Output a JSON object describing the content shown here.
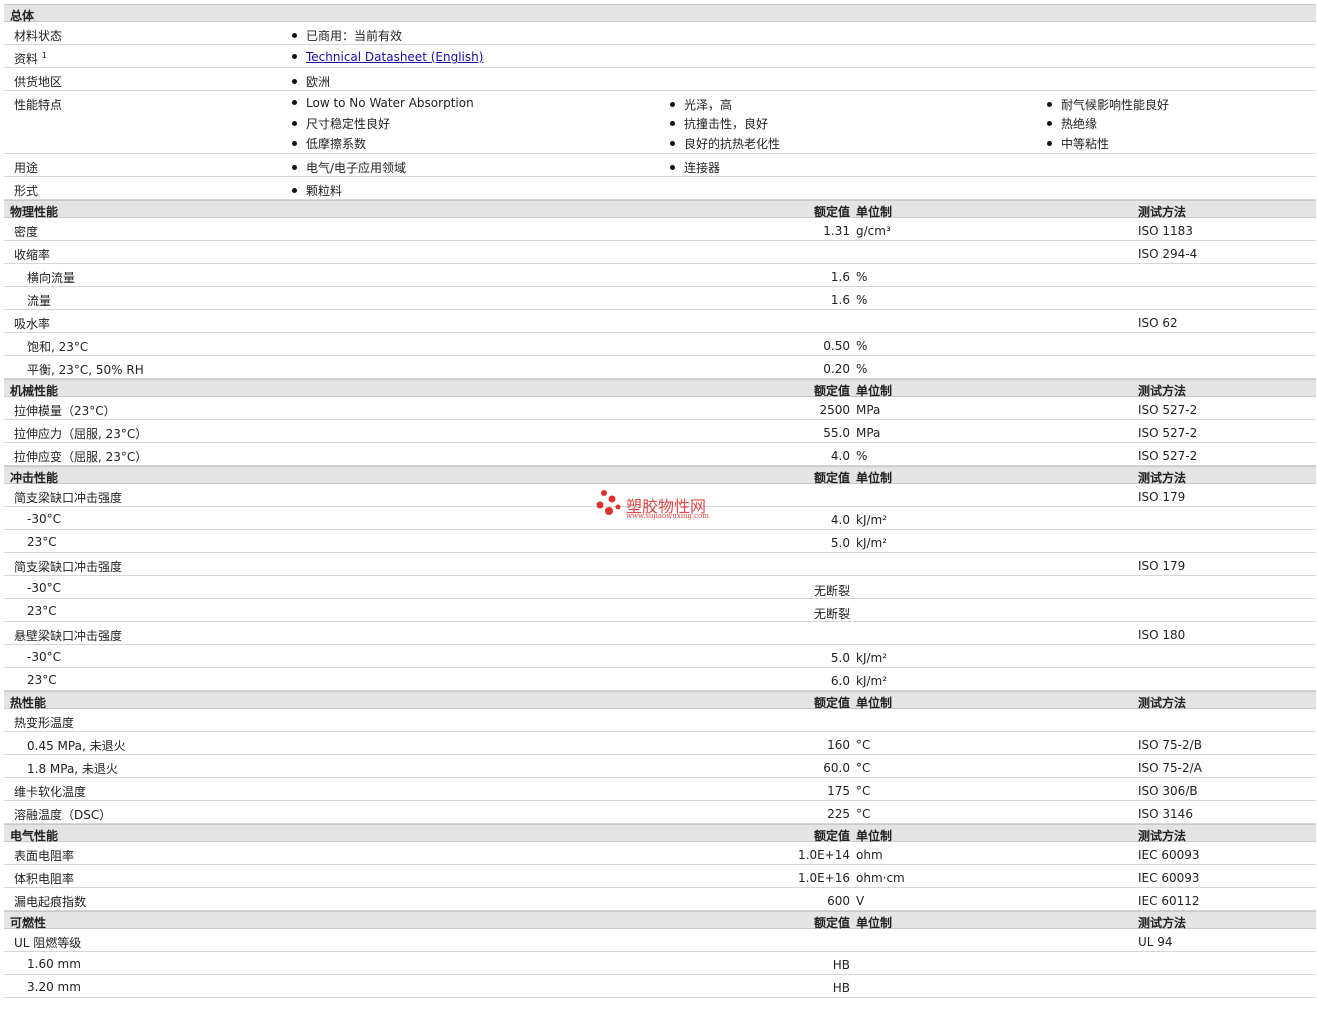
{
  "general": {
    "title": "总体",
    "material_status": {
      "label": "材料状态",
      "value": "已商用：当前有效"
    },
    "docs": {
      "label": "资料",
      "sup": "1",
      "link": "Technical Datasheet (English)"
    },
    "region": {
      "label": "供货地区",
      "value": "欧洲"
    },
    "features": {
      "label": "性能特点",
      "col1": [
        "Low to No Water Absorption",
        "尺寸稳定性良好",
        "低摩擦系数"
      ],
      "col2": [
        "光泽，高",
        "抗撞击性，良好",
        "良好的抗热老化性"
      ],
      "col3": [
        "耐气候影响性能良好",
        "热绝缘",
        "中等粘性"
      ]
    },
    "uses": {
      "label": "用途",
      "col1": "电气/电子应用领域",
      "col2": "连接器"
    },
    "form": {
      "label": "形式",
      "value": "颗粒料"
    }
  },
  "headers": {
    "value": "额定值",
    "unit": "单位制",
    "method": "测试方法"
  },
  "sections": [
    {
      "title": "物理性能",
      "rows": [
        {
          "label": "密度",
          "value": "1.31",
          "unit": "g/cm³",
          "method": "ISO 1183",
          "sub": false
        },
        {
          "label": "收缩率",
          "value": "",
          "unit": "",
          "method": "ISO 294-4",
          "sub": false
        },
        {
          "label": "横向流量",
          "value": "1.6",
          "unit": "%",
          "method": "",
          "sub": true
        },
        {
          "label": "流量",
          "value": "1.6",
          "unit": "%",
          "method": "",
          "sub": true
        },
        {
          "label": "吸水率",
          "value": "",
          "unit": "",
          "method": "ISO 62",
          "sub": false
        },
        {
          "label": "饱和, 23°C",
          "value": "0.50",
          "unit": "%",
          "method": "",
          "sub": true
        },
        {
          "label": "平衡, 23°C, 50% RH",
          "value": "0.20",
          "unit": "%",
          "method": "",
          "sub": true
        }
      ]
    },
    {
      "title": "机械性能",
      "rows": [
        {
          "label": "拉伸模量（23°C）",
          "value": "2500",
          "unit": "MPa",
          "method": "ISO 527-2",
          "sub": false
        },
        {
          "label": "拉伸应力（屈服, 23°C）",
          "value": "55.0",
          "unit": "MPa",
          "method": "ISO 527-2",
          "sub": false
        },
        {
          "label": "拉伸应变（屈服, 23°C）",
          "value": "4.0",
          "unit": "%",
          "method": "ISO 527-2",
          "sub": false
        }
      ]
    },
    {
      "title": "冲击性能",
      "rows": [
        {
          "label": "简支梁缺口冲击强度",
          "value": "",
          "unit": "",
          "method": "ISO 179",
          "sub": false
        },
        {
          "label": "-30°C",
          "value": "4.0",
          "unit": "kJ/m²",
          "method": "",
          "sub": true
        },
        {
          "label": "23°C",
          "value": "5.0",
          "unit": "kJ/m²",
          "method": "",
          "sub": true
        },
        {
          "label": "简支梁缺口冲击强度",
          "value": "",
          "unit": "",
          "method": "ISO 179",
          "sub": false
        },
        {
          "label": "-30°C",
          "value": "无断裂",
          "unit": "",
          "method": "",
          "sub": true
        },
        {
          "label": "23°C",
          "value": "无断裂",
          "unit": "",
          "method": "",
          "sub": true
        },
        {
          "label": "悬壁梁缺口冲击强度",
          "value": "",
          "unit": "",
          "method": "ISO 180",
          "sub": false
        },
        {
          "label": "-30°C",
          "value": "5.0",
          "unit": "kJ/m²",
          "method": "",
          "sub": true
        },
        {
          "label": "23°C",
          "value": "6.0",
          "unit": "kJ/m²",
          "method": "",
          "sub": true
        }
      ]
    },
    {
      "title": "热性能",
      "rows": [
        {
          "label": "热变形温度",
          "value": "",
          "unit": "",
          "method": "",
          "sub": false
        },
        {
          "label": "0.45 MPa, 未退火",
          "value": "160",
          "unit": "°C",
          "method": "ISO 75-2/B",
          "sub": true
        },
        {
          "label": "1.8 MPa, 未退火",
          "value": "60.0",
          "unit": "°C",
          "method": "ISO 75-2/A",
          "sub": true
        },
        {
          "label": "维卡软化温度",
          "value": "175",
          "unit": "°C",
          "method": "ISO 306/B",
          "sub": false
        },
        {
          "label": "溶融温度（DSC）",
          "value": "225",
          "unit": "°C",
          "method": "ISO 3146",
          "sub": false
        }
      ]
    },
    {
      "title": "电气性能",
      "rows": [
        {
          "label": "表面电阻率",
          "value": "1.0E+14",
          "unit": "ohm",
          "method": "IEC 60093",
          "sub": false
        },
        {
          "label": "体积电阻率",
          "value": "1.0E+16",
          "unit": "ohm·cm",
          "method": "IEC 60093",
          "sub": false
        },
        {
          "label": "漏电起痕指数",
          "value": "600",
          "unit": "V",
          "method": "IEC 60112",
          "sub": false
        }
      ]
    },
    {
      "title": "可燃性",
      "rows": [
        {
          "label": "UL 阻燃等级",
          "value": "",
          "unit": "",
          "method": "UL 94",
          "sub": false
        },
        {
          "label": "1.60 mm",
          "value": "HB",
          "unit": "",
          "method": "",
          "sub": true
        },
        {
          "label": "3.20 mm",
          "value": "HB",
          "unit": "",
          "method": "",
          "sub": true
        }
      ]
    }
  ],
  "watermark": {
    "title": "塑胶物性网",
    "url": "www.sujiaowuxing.com"
  }
}
